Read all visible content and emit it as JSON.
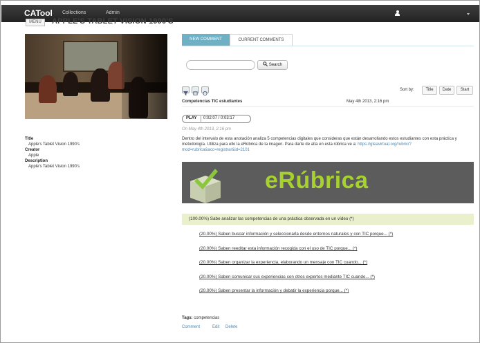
{
  "nav": {
    "brand": "CATool",
    "links": [
      "Collections",
      "Admin"
    ]
  },
  "header": {
    "menu_label": "MENU",
    "title": "APPLE'S TABLET VISION 1990'S"
  },
  "metadata": {
    "title_label": "Title",
    "title_value": "Apple's Tablet Vision 1990's",
    "creator_label": "Creator",
    "creator_value": "Apple",
    "description_label": "Description",
    "description_value": "Apple's Tablet Vision 1990's"
  },
  "tabs": [
    "NEW COMMENT",
    "CURRENT COMMENTS"
  ],
  "search": {
    "value": "",
    "button_label": "Search"
  },
  "sort": {
    "label": "Sort by:",
    "options": [
      "Title",
      "Date",
      "Start"
    ]
  },
  "comment": {
    "title": "Competencias TIC estudiantes",
    "date": "May 4th 2013, 2:16 pm",
    "play_label": "PLAY",
    "time_range": "0:02:07 / 0:03:17",
    "posted": "On May 4th 2013, 2:16 pm",
    "body": "Dentro del intervalo de esta anotación analiza 5 competencias digitales que consideras que están desarrollando estos estudiantes con esta práctica y metodología. Utiliza para ello la eRúbrica de la imagen. Para darte de alta en esta rúbrica ve a: ",
    "url": "https://gteavirtual.org/rubric/?mod=rubrica&acc=registrar&id=2101",
    "banner_text": "eRúbrica"
  },
  "rubric": {
    "main": "(100.00%) Sabe analizar las competencias de una práctica observada en un vídeo (*)",
    "items": [
      "(20.00%) Saben buscar información y seleccionarla desde entornos naturales y con TIC porque... (*)",
      "(20.00%) Saben reeditar esta información recogida con el uso de TIC porque... (*)",
      "(20.00%) Saben organizar la experiencia, elaborando un mensaje con TIC cuando... (*)",
      "(20.00%) Saben comunicar sus experiencias con otros expertos mediante TIC cuando... (*)",
      "(20.00%) Saben presentar la información y debatir la experiencia porque... (*)"
    ]
  },
  "tags": {
    "label": "Tags:",
    "value": "competencias"
  },
  "actions": [
    "Comment",
    "Edit",
    "Delete"
  ],
  "colors": {
    "navbar": "#2b2b2b",
    "tab_active": "#6fb0c5",
    "rubric_highlight": "#e9f0cb",
    "link": "#4a86b4",
    "banner_text": "#a7d12f"
  }
}
